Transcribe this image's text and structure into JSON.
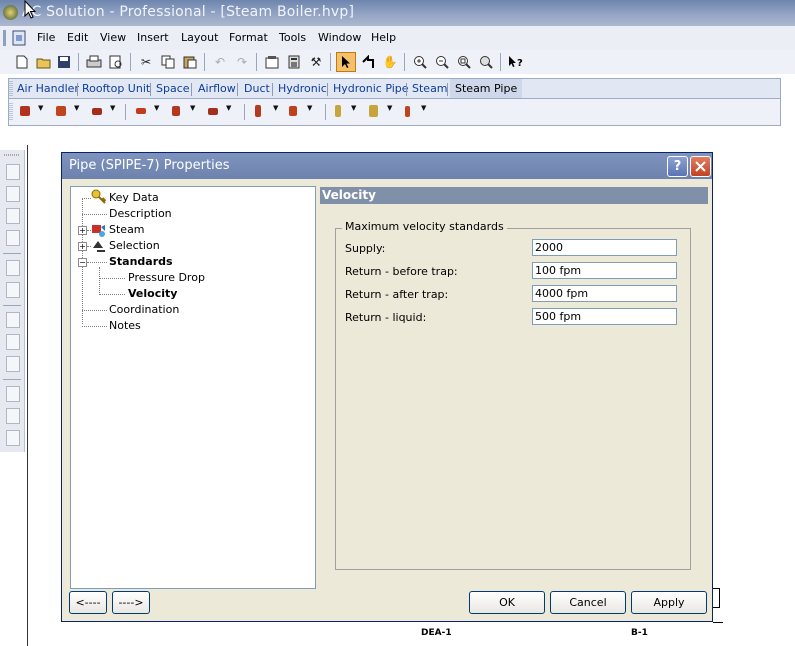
{
  "window": {
    "title": "AC Solution - Professional - [Steam Boiler.hvp]"
  },
  "menu": {
    "items": [
      "File",
      "Edit",
      "View",
      "Insert",
      "Layout",
      "Format",
      "Tools",
      "Window",
      "Help"
    ]
  },
  "tabs": {
    "items": [
      "Air Handler",
      "Rooftop Unit",
      "Space",
      "Airflow",
      "Duct",
      "Hydronic",
      "Hydronic Pipe",
      "Steam",
      "Steam Pipe"
    ],
    "active": "Steam Pipe"
  },
  "dialog": {
    "title": "Pipe (SPIPE-7) Properties",
    "help_icon": "?",
    "tree": {
      "items": [
        {
          "label": "Key Data",
          "icon": "key-icon"
        },
        {
          "label": "Description",
          "icon": ""
        },
        {
          "label": "Steam",
          "icon": "steam-icon"
        },
        {
          "label": "Selection",
          "icon": "selection-icon"
        },
        {
          "label": "Standards",
          "icon": ""
        },
        {
          "label": "Pressure Drop",
          "icon": ""
        },
        {
          "label": "Velocity",
          "icon": ""
        },
        {
          "label": "Coordination",
          "icon": ""
        },
        {
          "label": "Notes",
          "icon": ""
        }
      ],
      "selected": "Velocity"
    },
    "panel": {
      "header": "Velocity",
      "group_label": "Maximum velocity standards",
      "fields": [
        {
          "label": "Supply:",
          "value": "2000"
        },
        {
          "label": "Return - before trap:",
          "value": "100 fpm"
        },
        {
          "label": "Return - after trap:",
          "value": "4000 fpm"
        },
        {
          "label": "Return - liquid:",
          "value": "500 fpm"
        }
      ]
    },
    "buttons": {
      "back": "<----",
      "forward": "---->",
      "ok": "OK",
      "cancel": "Cancel",
      "apply": "Apply"
    }
  },
  "drawing": {
    "labels": [
      "DEA-1",
      "B-1"
    ]
  },
  "colors": {
    "titlebar": "#6e85ad",
    "dialog_title": "#7e93bd",
    "panel_header": "#8090a8",
    "tab_text": "#0e3c9a"
  }
}
